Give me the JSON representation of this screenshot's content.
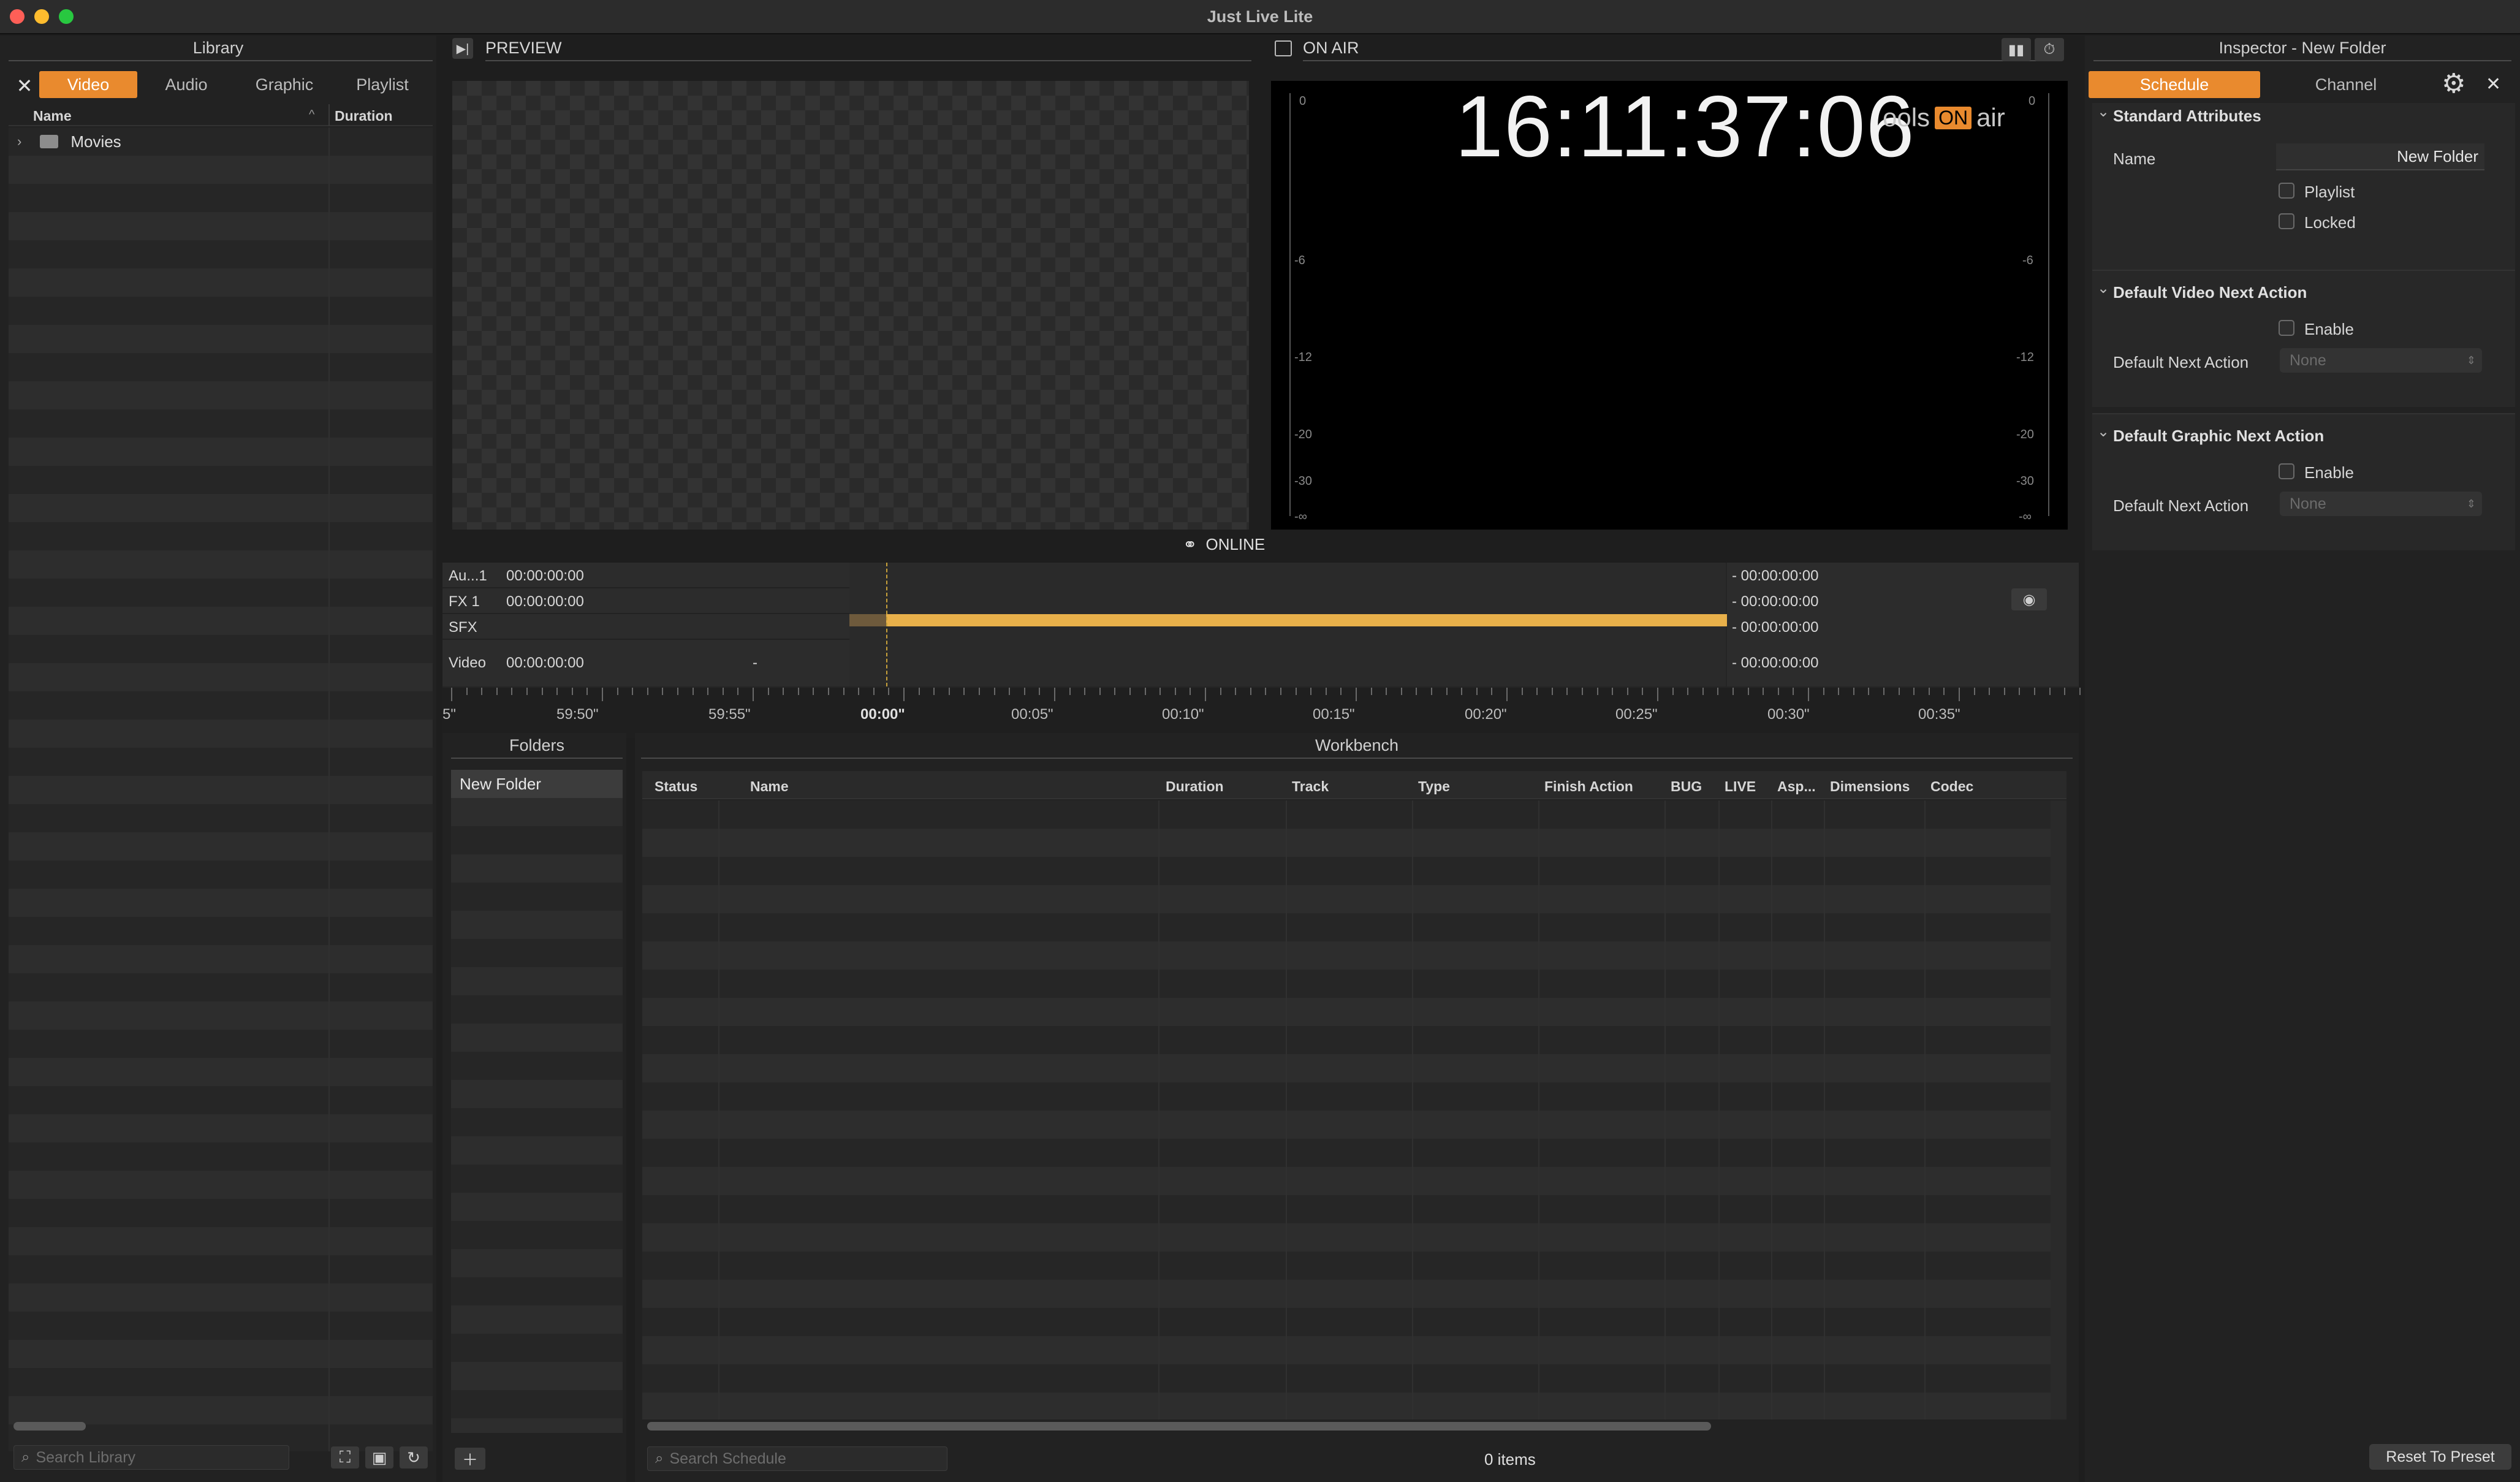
{
  "window": {
    "title": "Just Live Lite"
  },
  "library": {
    "title": "Library",
    "tabs": [
      {
        "label": "Video",
        "active": true
      },
      {
        "label": "Audio",
        "active": false
      },
      {
        "label": "Graphic",
        "active": false
      },
      {
        "label": "Playlist",
        "active": false
      }
    ],
    "columns": {
      "name": "Name",
      "duration": "Duration"
    },
    "items": [
      {
        "name": "Movies",
        "type": "folder"
      }
    ],
    "search_placeholder": "Search Library"
  },
  "preview": {
    "title": "PREVIEW"
  },
  "on_air": {
    "title": "ON AIR",
    "clock": "16:11:37:06",
    "logo_left": "ools",
    "logo_badge": "ON",
    "logo_right": "air",
    "meter_labels": [
      "0",
      "-6",
      "-12",
      "-20",
      "-30",
      "-∞"
    ]
  },
  "status": {
    "label": "ONLINE"
  },
  "timeline": {
    "tracks": [
      {
        "name": "Au...1",
        "time": "00:00:00:00",
        "extra": "",
        "remaining": "- 00:00:00:00"
      },
      {
        "name": "FX 1",
        "time": "00:00:00:00",
        "extra": "",
        "remaining": "- 00:00:00:00"
      },
      {
        "name": "SFX",
        "time": "",
        "extra": "",
        "remaining": "- 00:00:00:00"
      },
      {
        "name": "Video",
        "time": "00:00:00:00",
        "extra": "-",
        "remaining": "- 00:00:00:00"
      }
    ],
    "ticks": [
      "5\"",
      "59:50\"",
      "59:55\"",
      "00:00\"",
      "00:05\"",
      "00:10\"",
      "00:15\"",
      "00:20\"",
      "00:25\"",
      "00:30\"",
      "00:35\""
    ]
  },
  "folders": {
    "title": "Folders",
    "items": [
      "New Folder"
    ]
  },
  "workbench": {
    "title": "Workbench",
    "columns": [
      "Status",
      "Name",
      "Duration",
      "Track",
      "Type",
      "Finish Action",
      "BUG",
      "LIVE",
      "Asp...",
      "Dimensions",
      "Codec"
    ],
    "search_placeholder": "Search Schedule",
    "count": "0 items"
  },
  "inspector": {
    "title": "Inspector - New Folder",
    "tabs": [
      {
        "label": "Schedule",
        "active": true
      },
      {
        "label": "Channel",
        "active": false
      }
    ],
    "sections": {
      "standard": {
        "title": "Standard Attributes",
        "name_label": "Name",
        "name_value": "New Folder",
        "playlist_label": "Playlist",
        "locked_label": "Locked"
      },
      "video_next": {
        "title": "Default Video Next Action",
        "enable_label": "Enable",
        "action_label": "Default Next Action",
        "action_value": "None"
      },
      "graphic_next": {
        "title": "Default Graphic Next Action",
        "enable_label": "Enable",
        "action_label": "Default Next Action",
        "action_value": "None"
      }
    },
    "reset_label": "Reset To Preset"
  },
  "colors": {
    "accent": "#e98a2e",
    "timeline_bar": "#e8b04a"
  }
}
